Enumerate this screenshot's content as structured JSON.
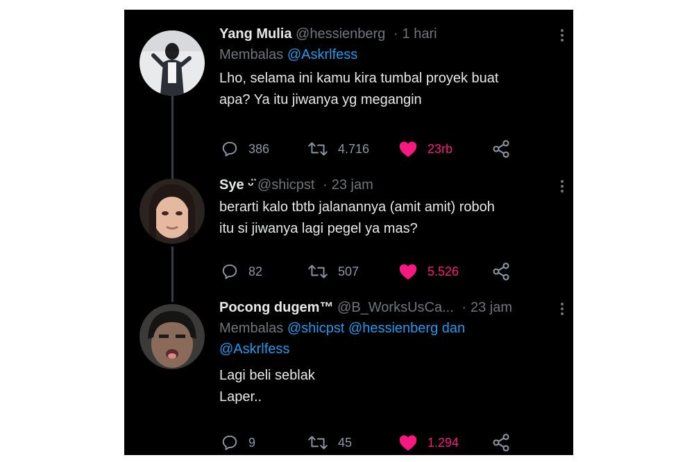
{
  "tweets": [
    {
      "name": "Yang Mulia",
      "handle": "@hessienberg",
      "time": "1 hari",
      "reply_prefix": "Membalas",
      "reply_mentions": "@Askrlfess",
      "text_lines": [
        "Lho, selama ini kamu kira tumbal proyek buat",
        "apa? Ya itu jiwanya yg megangin"
      ],
      "replies": "386",
      "retweets": "4.716",
      "likes": "23rb"
    },
    {
      "name": "Sye ᵕ̈",
      "handle": "@shicpst",
      "time": "23 jam",
      "text_lines": [
        "berarti kalo tbtb jalanannya (amit amit) roboh",
        "itu si jiwanya lagi pegel ya mas?"
      ],
      "replies": "82",
      "retweets": "507",
      "likes": "5.526"
    },
    {
      "name": "Pocong dugem™",
      "handle": "@B_WorksUsCa...",
      "time": "23 jam",
      "reply_prefix": "Membalas",
      "reply_mentions_line1": "@shicpst @hessienberg dan",
      "reply_mentions_line2": "@Askrlfess",
      "text_lines": [
        "Lagi beli seblak",
        "Laper.."
      ],
      "replies": "9",
      "retweets": "45",
      "likes": "1.294"
    }
  ],
  "colors": {
    "background": "#000000",
    "text": "#e7e9ea",
    "muted": "#71767b",
    "mention": "#1d9bf0",
    "like": "#f91880"
  },
  "icons": [
    "reply-icon",
    "retweet-icon",
    "heart-icon",
    "share-icon",
    "more-icon"
  ]
}
